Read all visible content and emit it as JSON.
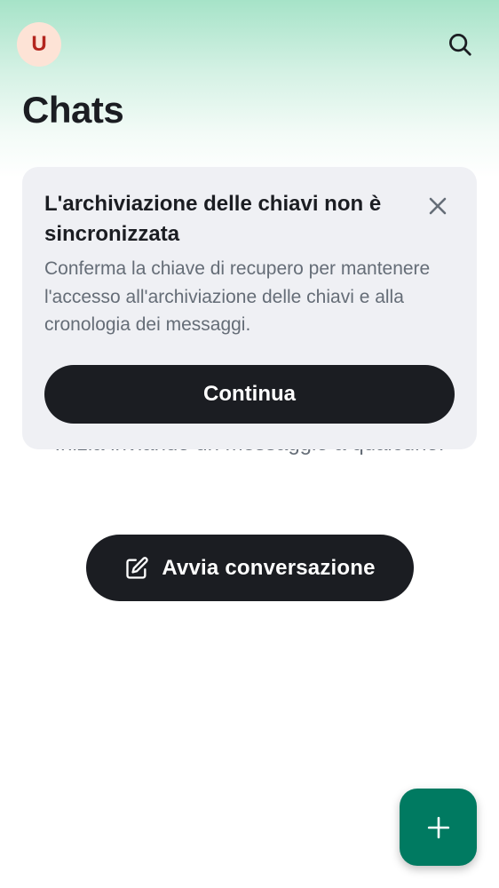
{
  "header": {
    "avatar_letter": "U",
    "search_icon": "search-icon"
  },
  "page": {
    "title": "Chats"
  },
  "empty_state": {
    "text": "Inizia inviando un messaggio a qualcuno."
  },
  "start_chat": {
    "icon": "compose-icon",
    "label": "Avvia conversazione"
  },
  "banner": {
    "title": "L'archiviazione delle chiavi non è sincronizzata",
    "text": "Conferma la chiave di recupero per mantenere l'accesso all'archiviazione delle chiavi e alla cronologia dei messaggi.",
    "close_icon": "close-icon",
    "button_label": "Continua"
  },
  "fab": {
    "icon": "plus-icon"
  },
  "colors": {
    "accent": "#007a61",
    "button_dark": "#1b1d22",
    "banner_bg": "#eff0f4",
    "avatar_bg": "#fde3d6",
    "avatar_text": "#b3261e"
  }
}
